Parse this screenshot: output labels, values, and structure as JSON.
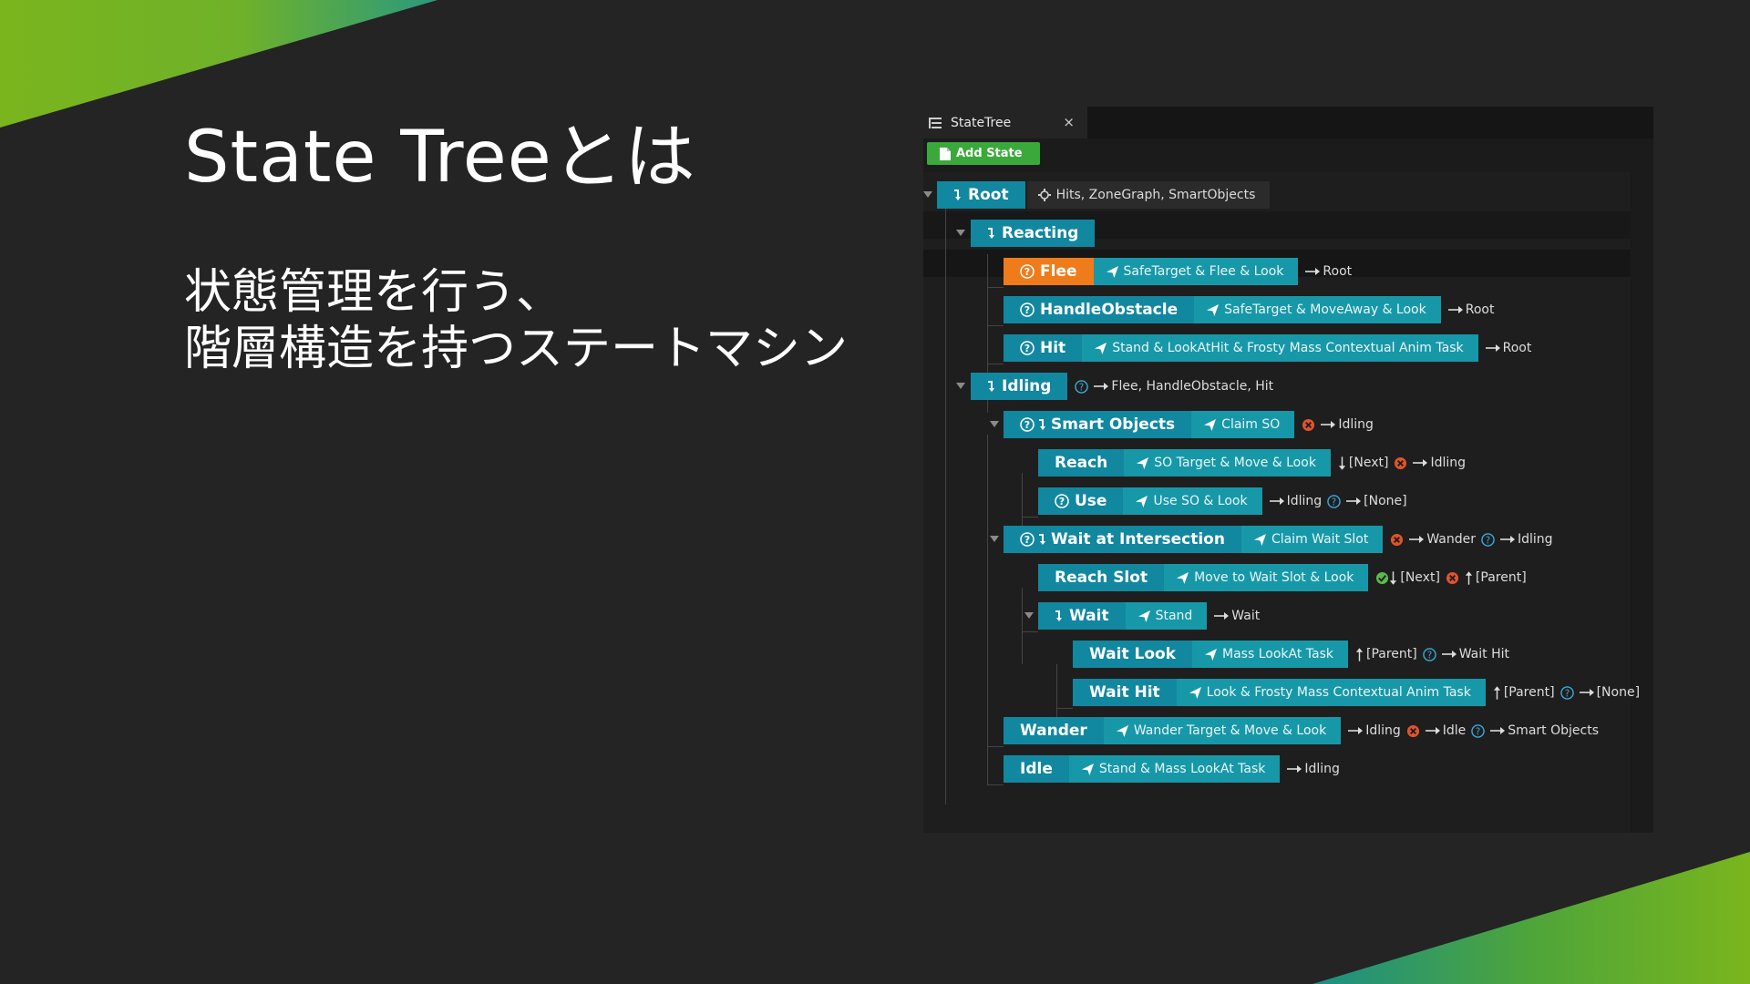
{
  "slide": {
    "title": "State Treeとは",
    "subtitle_line1": "状態管理を行う、",
    "subtitle_line2": "階層構造を持つステートマシン"
  },
  "colors": {
    "background": "#242424",
    "accent_green": "#7ab51d",
    "accent_teal": "#1b8f86",
    "state_blue": "#1287a0",
    "task_teal": "#1798a8",
    "selected_orange": "#f07b1b",
    "add_green": "#3aa83a",
    "error_red": "#e0532c",
    "success_green": "#5cb84a",
    "help_blue": "#3ea8d8"
  },
  "editor": {
    "tab_title": "StateTree",
    "tab_close": "×",
    "add_state_label": "Add State",
    "root": {
      "name": "Root",
      "params": "Hits, ZoneGraph, SmartObjects"
    },
    "reacting": {
      "name": "Reacting"
    },
    "flee": {
      "name": "Flee",
      "task": "SafeTarget & Flee & Look",
      "t1": "Root"
    },
    "handle_obstacle": {
      "name": "HandleObstacle",
      "task": "SafeTarget & MoveAway & Look",
      "t1": "Root"
    },
    "hit": {
      "name": "Hit",
      "task": "Stand & LookAtHit & Frosty Mass Contextual Anim Task",
      "t1": "Root"
    },
    "idling": {
      "name": "Idling",
      "t1": "Flee, HandleObstacle, Hit"
    },
    "smart_objects": {
      "name": "Smart Objects",
      "task": "Claim SO",
      "t1": "Idling"
    },
    "reach": {
      "name": "Reach",
      "task": "SO Target & Move & Look",
      "t1": "[Next]",
      "t2": "Idling"
    },
    "use": {
      "name": "Use",
      "task": "Use SO & Look",
      "t1": "Idling",
      "t2": "[None]"
    },
    "wait_at_intersection": {
      "name": "Wait at Intersection",
      "task": "Claim Wait Slot",
      "t1": "Wander",
      "t2": "Idling"
    },
    "reach_slot": {
      "name": "Reach Slot",
      "task": "Move to Wait Slot & Look",
      "t1": "[Next]",
      "t2": "[Parent]"
    },
    "wait": {
      "name": "Wait",
      "task": "Stand",
      "t1": "Wait"
    },
    "wait_look": {
      "name": "Wait Look",
      "task": "Mass LookAt Task",
      "t1": "[Parent]",
      "t2": "Wait Hit"
    },
    "wait_hit": {
      "name": "Wait Hit",
      "task": "Look & Frosty Mass Contextual Anim Task",
      "t1": "[Parent]",
      "t2": "[None]"
    },
    "wander": {
      "name": "Wander",
      "task": "Wander Target & Move & Look",
      "t1": "Idling",
      "t2": "Idle",
      "t3": "Smart Objects"
    },
    "idle": {
      "name": "Idle",
      "task": "Stand & Mass LookAt Task",
      "t1": "Idling"
    }
  }
}
